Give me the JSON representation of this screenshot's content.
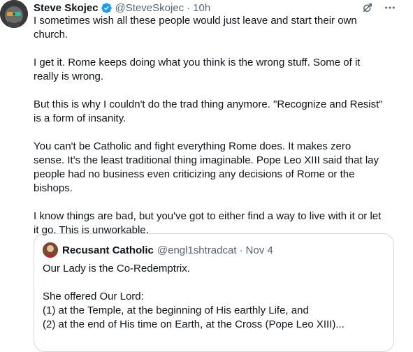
{
  "tweet": {
    "author_name": "Steve Skojec",
    "handle": "@SteveSkojec",
    "separator": "·",
    "time": "10h",
    "paragraphs": [
      "I sometimes wish all these people would just leave and start their own church.",
      "I get it. Rome keeps doing what you think is the wrong stuff. Some of it really is wrong.",
      "But this is why I couldn't do the trad thing anymore. \"Recognize and Resist\" is a form of insanity.",
      "You can't be Catholic and fight everything Rome does. It makes zero sense. It's the least traditional thing imaginable. Pope Leo XIII said that lay people had no business even criticizing any decisions of Rome or the bishops.",
      "I know things are bad, but you've got to either find a way to live with it or let it go. This is unworkable."
    ]
  },
  "quoted_tweet": {
    "author_name": "Recusant Catholic",
    "handle": "@engl1shtradcat",
    "separator": "·",
    "time": "Nov 4",
    "line1": "Our Lady is the Co-Redemptrix.",
    "line2": "She offered Our Lord:",
    "line3": "(1) at the Temple, at the beginning of His earthly Life, and",
    "line4": "(2) at the end of His time on Earth, at the Cross (Pope Leo XIII)..."
  },
  "colors": {
    "verified": "#1d9bf0",
    "secondary_text": "#536471",
    "border": "#cfd9de"
  },
  "icons": [
    "verified-badge-icon",
    "grok-icon",
    "more-icon"
  ]
}
